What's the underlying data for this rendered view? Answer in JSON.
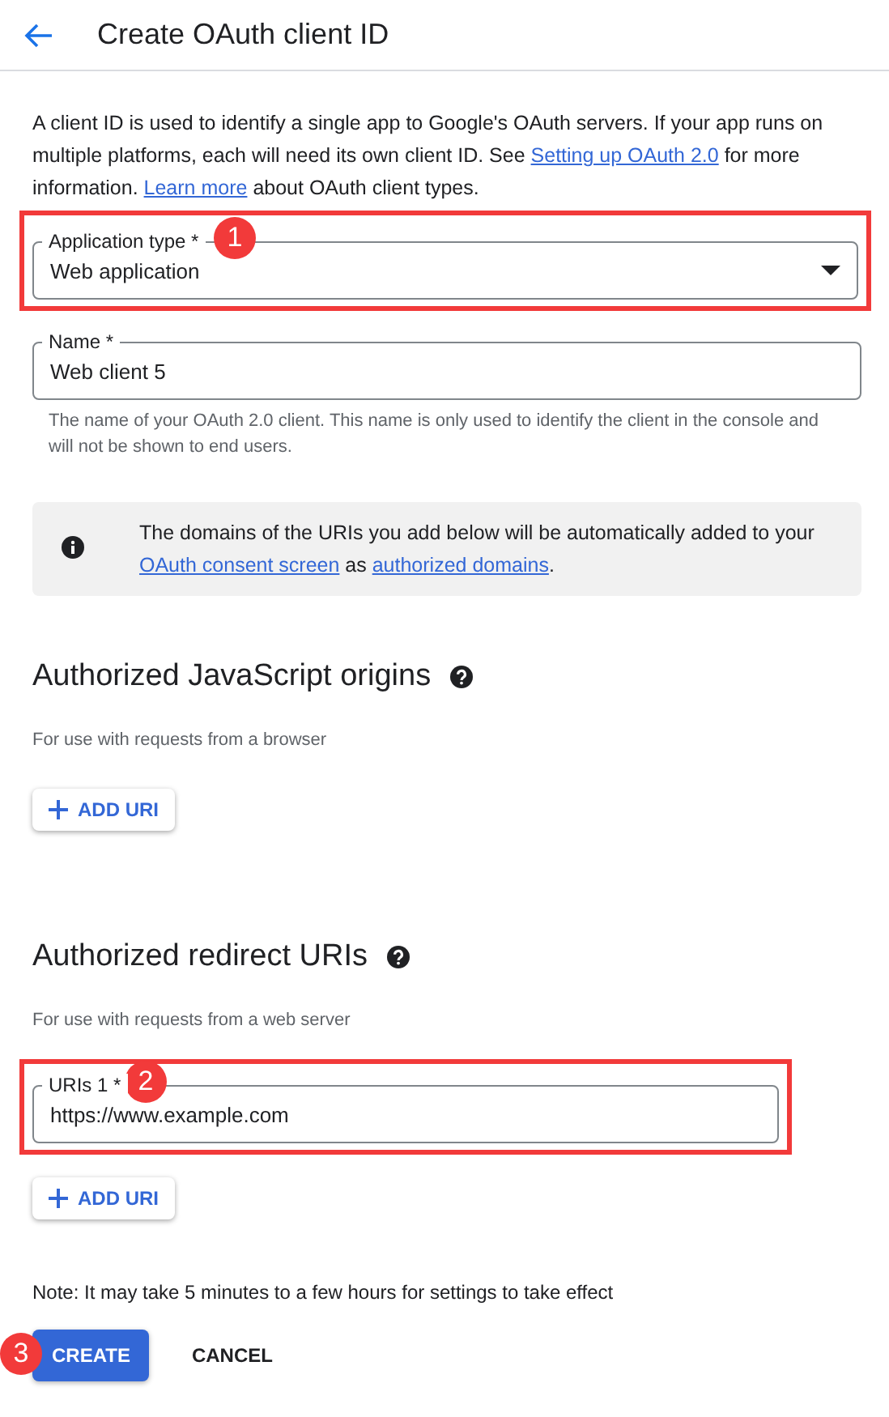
{
  "header": {
    "title": "Create OAuth client ID"
  },
  "intro": [
    {
      "kind": "text",
      "text": "A client ID is used to identify a single app to Google's OAuth servers. If your app runs on multiple platforms, each will need its own client ID. See "
    },
    {
      "kind": "link",
      "text": "Setting up OAuth 2.0"
    },
    {
      "kind": "text",
      "text": " for more information. "
    },
    {
      "kind": "link",
      "text": "Learn more"
    },
    {
      "kind": "text",
      "text": " about OAuth client types."
    }
  ],
  "application_type": {
    "label": "Application type *",
    "value": "Web application",
    "badge": "1"
  },
  "name_field": {
    "label": "Name *",
    "value": "Web client 5",
    "helper": "The name of your OAuth 2.0 client. This name is only used to identify the client in the console and will not be shown to end users."
  },
  "info": [
    {
      "kind": "text",
      "text": "The domains of the URIs you add below will be automatically added to your "
    },
    {
      "kind": "link",
      "text": "OAuth consent screen"
    },
    {
      "kind": "text",
      "text": " as "
    },
    {
      "kind": "link",
      "text": "authorized domains"
    },
    {
      "kind": "text",
      "text": "."
    }
  ],
  "sections": [
    {
      "title": "Authorized JavaScript origins",
      "subtitle": "For use with requests from a browser",
      "add_button": "ADD URI"
    },
    {
      "title": "Authorized redirect URIs",
      "subtitle": "For use with requests from a web server",
      "uris": [
        {
          "label": "URIs 1 *",
          "value": "https://www.example.com",
          "badge": "2"
        }
      ],
      "add_button": "ADD URI"
    }
  ],
  "note": "Note: It may take 5 minutes to a few hours for settings to take effect",
  "buttons": [
    {
      "kind": "primary",
      "label": "CREATE",
      "badge": "3"
    },
    {
      "kind": "text",
      "label": "CANCEL"
    }
  ]
}
